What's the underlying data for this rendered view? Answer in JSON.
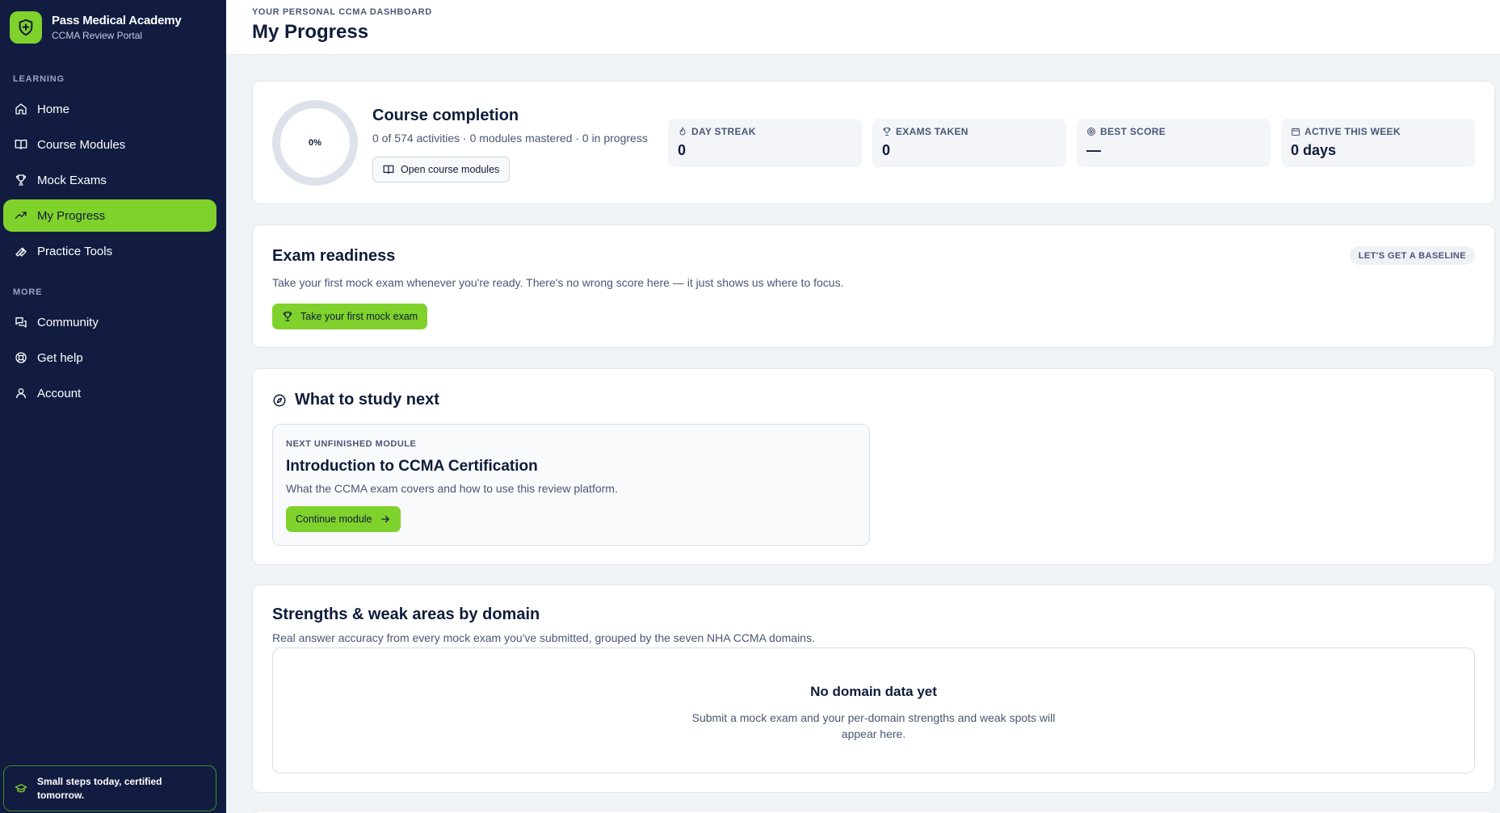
{
  "brand": {
    "name": "Pass Medical Academy",
    "subtitle": "CCMA Review Portal",
    "logo_icon": "shield-plus-icon"
  },
  "sidebar": {
    "section_learning": "LEARNING",
    "learning_items": [
      {
        "label": "Home",
        "icon": "home-icon"
      },
      {
        "label": "Course Modules",
        "icon": "book-open-icon"
      },
      {
        "label": "Mock Exams",
        "icon": "trophy-icon"
      },
      {
        "label": "My Progress",
        "icon": "trending-up-icon",
        "active": true
      },
      {
        "label": "Practice Tools",
        "icon": "wrench-icon"
      }
    ],
    "section_more": "MORE",
    "more_items": [
      {
        "label": "Community",
        "icon": "chat-icon"
      },
      {
        "label": "Get help",
        "icon": "lifebuoy-icon"
      },
      {
        "label": "Account",
        "icon": "user-icon"
      }
    ],
    "tagline": "Small steps today, certified tomorrow."
  },
  "header": {
    "eyebrow": "YOUR PERSONAL CCMA DASHBOARD",
    "title": "My Progress"
  },
  "course_completion": {
    "percent_label": "0%",
    "percent": 0,
    "title": "Course completion",
    "summary": "0 of 574 activities · 0 modules mastered · 0 in progress",
    "button": "Open course modules",
    "stats": [
      {
        "label": "DAY STREAK",
        "value": "0",
        "icon": "flame-icon"
      },
      {
        "label": "EXAMS TAKEN",
        "value": "0",
        "icon": "trophy-icon"
      },
      {
        "label": "BEST SCORE",
        "value": "—",
        "icon": "target-icon"
      },
      {
        "label": "ACTIVE THIS WEEK",
        "value": "0 days",
        "icon": "calendar-icon"
      }
    ]
  },
  "exam_readiness": {
    "title": "Exam readiness",
    "badge": "LET'S GET A BASELINE",
    "description": "Take your first mock exam whenever you're ready. There's no wrong score here — it just shows us where to focus.",
    "button": "Take your first mock exam"
  },
  "study_next": {
    "title": "What to study next",
    "eyebrow": "NEXT UNFINISHED MODULE",
    "module_title": "Introduction to CCMA Certification",
    "module_desc": "What the CCMA exam covers and how to use this review platform.",
    "button": "Continue module"
  },
  "strengths": {
    "title": "Strengths & weak areas by domain",
    "subtitle": "Real answer accuracy from every mock exam you've submitted, grouped by the seven NHA CCMA domains.",
    "empty_title": "No domain data yet",
    "empty_desc": "Submit a mock exam and your per-domain strengths and weak spots will appear here."
  },
  "colors": {
    "sidebar_bg": "#111c40",
    "accent": "#7fd12b",
    "text": "#0f1c3a",
    "muted": "#4a5674"
  }
}
